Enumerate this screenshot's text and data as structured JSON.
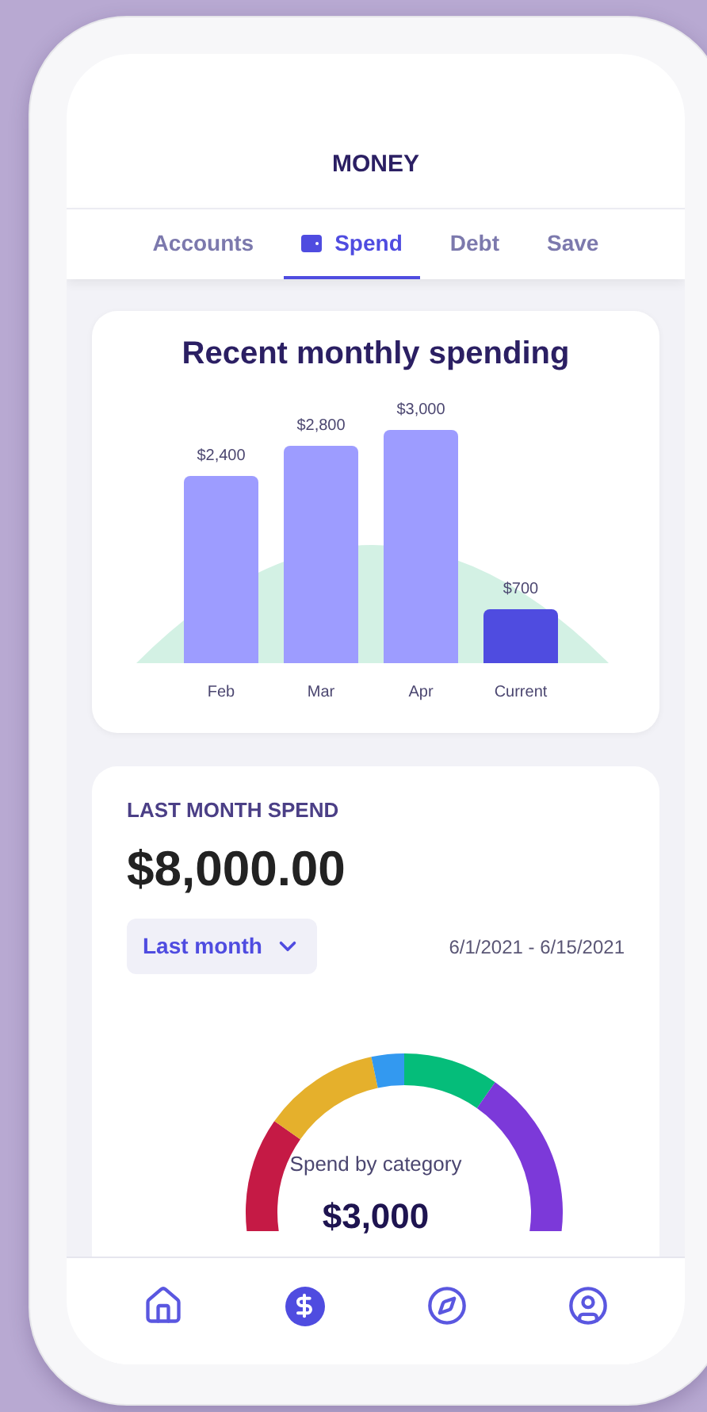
{
  "header": {
    "title": "MONEY"
  },
  "tabs": [
    {
      "label": "Accounts",
      "selected": false
    },
    {
      "label": "Spend",
      "selected": true
    },
    {
      "label": "Debt",
      "selected": false
    },
    {
      "label": "Save",
      "selected": false
    }
  ],
  "spending_card": {
    "title": "Recent monthly spending",
    "chart_data": {
      "type": "bar",
      "categories": [
        "Feb",
        "Mar",
        "Apr",
        "Current"
      ],
      "values": [
        2400,
        2800,
        3000,
        700
      ],
      "value_labels": [
        "$2,400",
        "$2,800",
        "$3,000",
        "$700"
      ]
    }
  },
  "last_month_card": {
    "heading": "LAST MONTH SPEND",
    "amount": "$8,000.00",
    "period_select": {
      "value": "Last month"
    },
    "date_range": "6/1/2021 - 6/15/2021",
    "gauge": {
      "caption": "Spend by category",
      "total": "$3,000"
    }
  },
  "bottom_nav": [
    {
      "kind": "home",
      "selected": false
    },
    {
      "kind": "money",
      "selected": true
    },
    {
      "kind": "explore",
      "selected": false
    },
    {
      "kind": "profile",
      "selected": false
    }
  ]
}
